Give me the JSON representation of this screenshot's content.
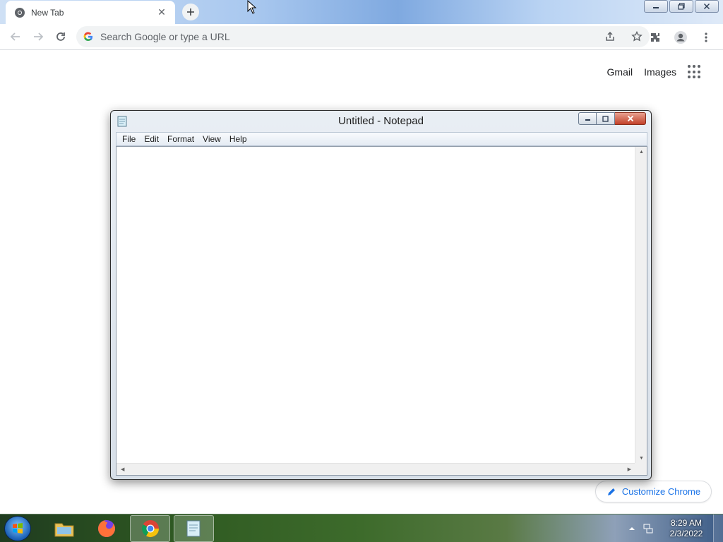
{
  "chrome": {
    "tab_title": "New Tab",
    "tab_close": "✕",
    "newtab_plus": "+",
    "omnibox_placeholder": "Search Google or type a URL",
    "ntp_gmail": "Gmail",
    "ntp_images": "Images",
    "customize_label": "Customize Chrome"
  },
  "notepad": {
    "title": "Untitled - Notepad",
    "menu": [
      "File",
      "Edit",
      "Format",
      "View",
      "Help"
    ],
    "content": ""
  },
  "taskbar": {
    "apps": [
      "explorer-icon",
      "firefox-icon",
      "chrome-icon",
      "notepad-icon"
    ],
    "clock_time": "8:29 AM",
    "clock_date": "2/3/2022"
  },
  "colors": {
    "chrome_accent": "#1a73e8",
    "notepad_close": "#c2412a"
  }
}
